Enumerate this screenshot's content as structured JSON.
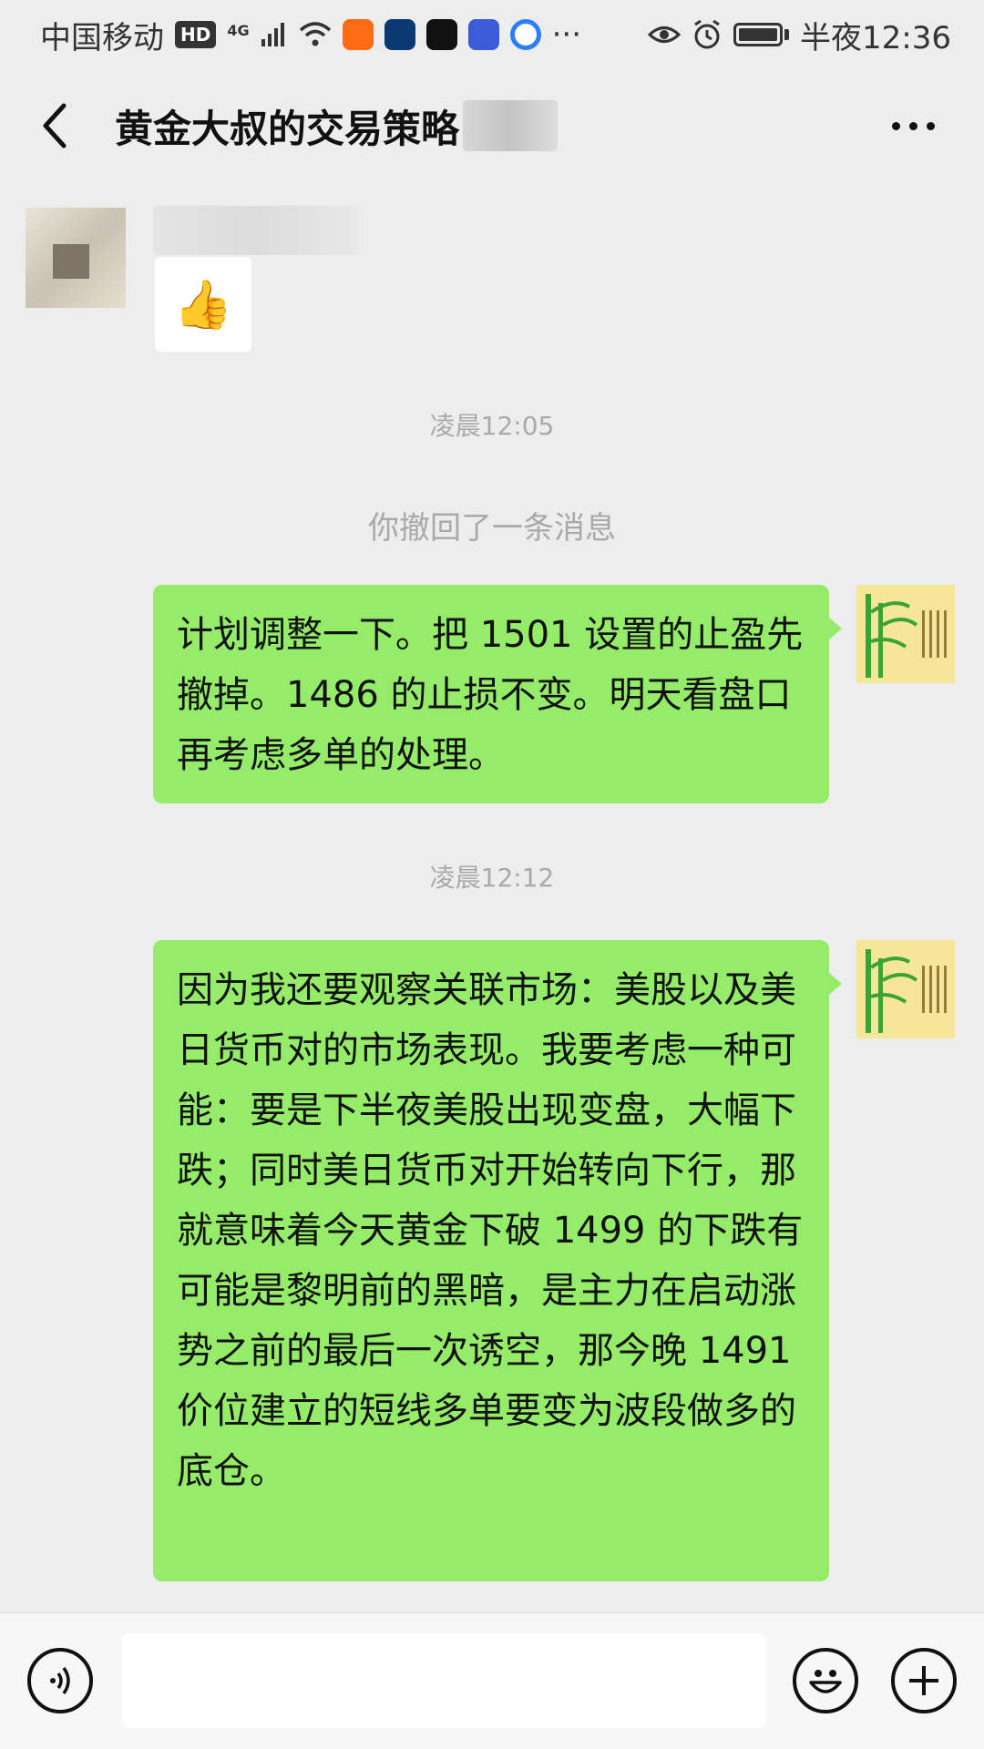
{
  "status_bar": {
    "carrier": "中国移动",
    "hd": "HD",
    "network": "4G",
    "ellipsis": "···",
    "time": "半夜12:36"
  },
  "nav": {
    "title": "黄金大叔的交易策略"
  },
  "messages": {
    "thumbs_emoji": "👍",
    "ts1": "凌晨12:05",
    "recall_notice": "你撤回了一条消息",
    "msg1": "计划调整一下。把 1501 设置的止盈先撤掉。1486 的止损不变。明天看盘口再考虑多单的处理。",
    "ts2": "凌晨12:12",
    "msg2": "因为我还要观察关联市场：美股以及美日货币对的市场表现。我要考虑一种可能：要是下半夜美股出现变盘，大幅下跌；同时美日货币对开始转向下行，那就意味着今天黄金下破 1499 的下跌有可能是黎明前的黑暗，是主力在启动涨势之前的最后一次诱空，那今晚 1491 价位建立的短线多单要变为波段做多的底仓。"
  },
  "input": {
    "value": ""
  },
  "colors": {
    "bubble_green": "#95ec69",
    "background": "#ededed"
  }
}
